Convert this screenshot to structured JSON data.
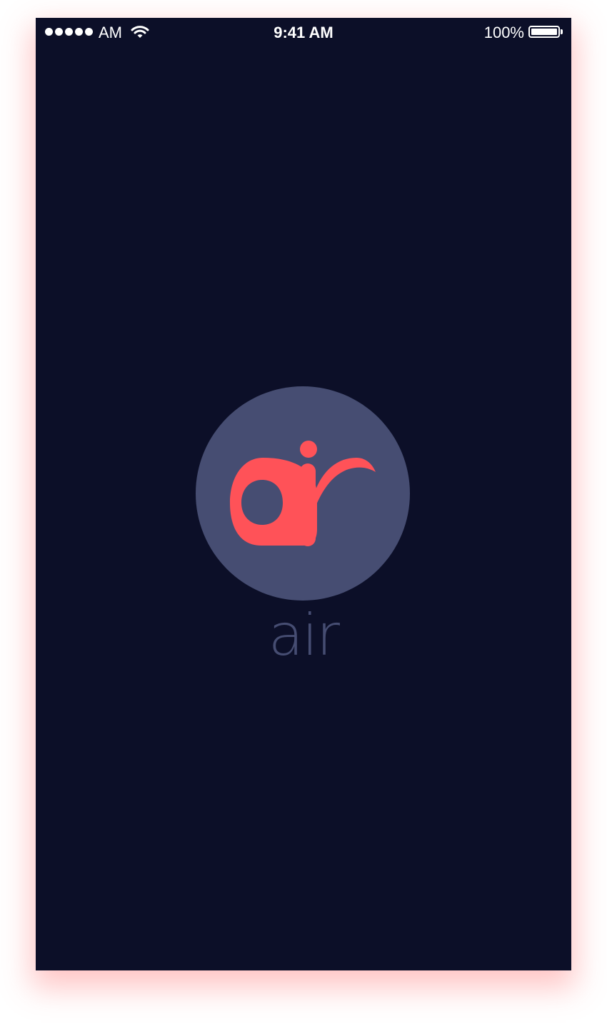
{
  "status_bar": {
    "carrier": "AM",
    "time": "9:41 AM",
    "battery_percent": "100%",
    "signal_bars": 5,
    "icons": [
      "signal-icon",
      "wifi-icon",
      "battery-icon"
    ]
  },
  "splash": {
    "app_name": "air",
    "logo": "air-logo-mark"
  },
  "colors": {
    "background": "#0c0f28",
    "circle": "#464d72",
    "logo": "#ff5258",
    "wordmark": "#464d72",
    "status_text": "#ffffff"
  }
}
